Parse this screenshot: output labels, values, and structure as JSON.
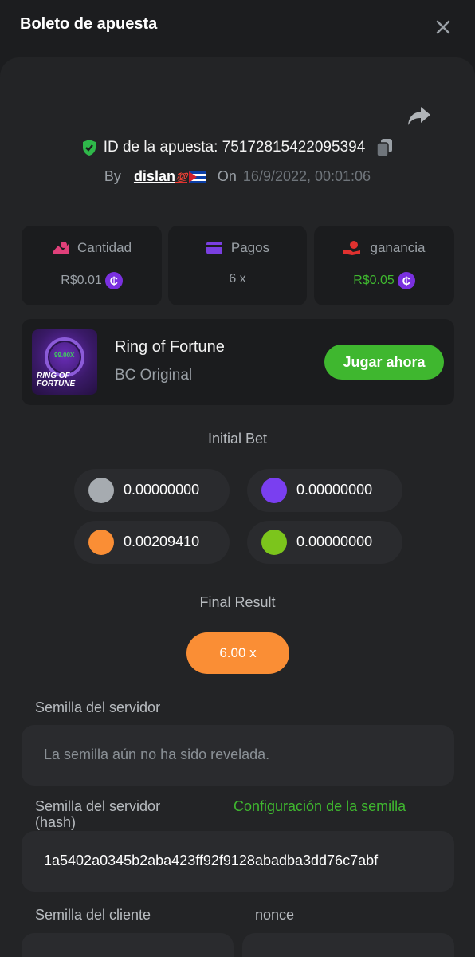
{
  "header": {
    "title": "Boleto de apuesta",
    "close_icon": "close-icon"
  },
  "bet": {
    "id_label": "ID de la apuesta: 75172815422095394",
    "by_label": "By",
    "username": "dislan",
    "username_suffix": "💯",
    "on_label": "On",
    "date": "16/9/2022, 00:01:06"
  },
  "stats": [
    {
      "label": "Cantidad",
      "value": "R$0.01",
      "icon": "coins-icon",
      "icon_color": "#e0407a",
      "value_color": "#9aa0a6",
      "coin": true
    },
    {
      "label": "Pagos",
      "value": "6 x",
      "icon": "card-icon",
      "icon_color": "#7a3fe0",
      "value_color": "#9aa0a6",
      "coin": false
    },
    {
      "label": "ganancia",
      "value": "R$0.05",
      "icon": "hand-icon",
      "icon_color": "#e0312f",
      "value_color": "#3fb72f",
      "coin": true
    }
  ],
  "game": {
    "name": "Ring of Fortune",
    "subtitle": "BC Original",
    "play_label": "Jugar ahora",
    "thumb_multiplier": "99.00X",
    "thumb_title": "RING OF FORTUNE"
  },
  "initial_bet": {
    "title": "Initial Bet",
    "chips": [
      {
        "amount": "0.00000000",
        "color": "#a6abb0"
      },
      {
        "amount": "0.00000000",
        "color": "#7a3ff0"
      },
      {
        "amount": "0.00209410",
        "color": "#fa8e35"
      },
      {
        "amount": "0.00000000",
        "color": "#7cc51c"
      }
    ]
  },
  "final_result": {
    "title": "Final Result",
    "value": "6.00 x"
  },
  "fields": {
    "server_seed_label": "Semilla del servidor",
    "server_seed_value": "La semilla aún no ha sido revelada.",
    "server_hash_label": "Semilla del servidor (hash)",
    "seed_config_link": "Configuración de la semilla",
    "server_hash_value": "1a5402a0345b2aba423ff92f9128abadba3dd76c7abf",
    "client_seed_label": "Semilla del cliente",
    "nonce_label": "nonce"
  },
  "colors": {
    "accent_green": "#3fb72f",
    "accent_orange": "#fa8e35",
    "background": "#1c1d1f",
    "panel": "#232426"
  }
}
